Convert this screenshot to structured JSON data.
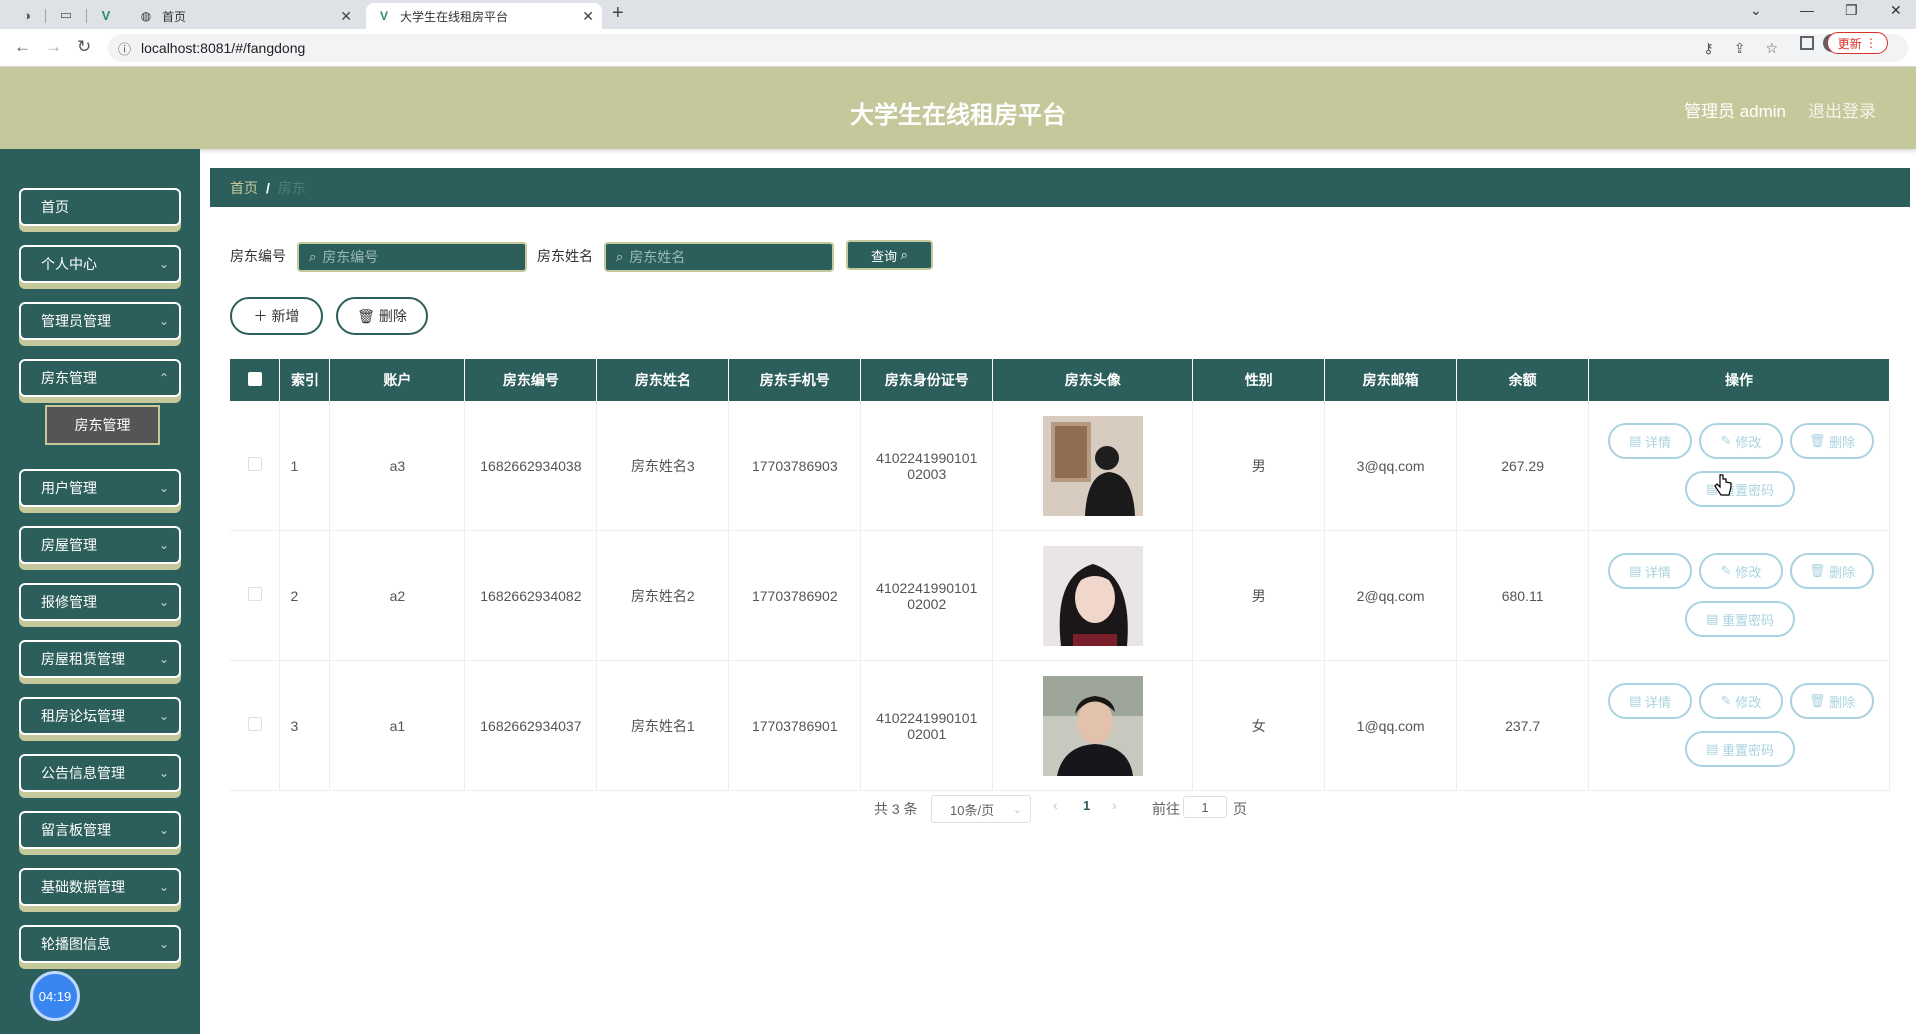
{
  "browser": {
    "tabs": [
      {
        "label": "首页",
        "favicon": "globe-icon"
      },
      {
        "label": "大学生在线租房平台",
        "favicon": "vue-icon"
      }
    ],
    "url": "localhost:8081/#/fangdong",
    "update_label": "更新"
  },
  "header": {
    "title": "大学生在线租房平台",
    "user": "管理员 admin",
    "logout": "退出登录"
  },
  "sidebar": {
    "items": [
      {
        "label": "首页"
      },
      {
        "label": "个人中心"
      },
      {
        "label": "管理员管理"
      },
      {
        "label": "房东管理"
      },
      {
        "label": "用户管理"
      },
      {
        "label": "房屋管理"
      },
      {
        "label": "报修管理"
      },
      {
        "label": "房屋租赁管理"
      },
      {
        "label": "租房论坛管理"
      },
      {
        "label": "公告信息管理"
      },
      {
        "label": "留言板管理"
      },
      {
        "label": "基础数据管理"
      },
      {
        "label": "轮播图信息"
      }
    ],
    "submenu_active": "房东管理",
    "clock": "04:19"
  },
  "breadcrumb": {
    "home": "首页",
    "sep": "/",
    "current": "房东"
  },
  "search": {
    "label_id": "房东编号",
    "placeholder_id": "房东编号",
    "label_name": "房东姓名",
    "placeholder_name": "房东姓名",
    "query": "查询"
  },
  "actions": {
    "add": "新增",
    "delete": "删除"
  },
  "table": {
    "headers": [
      "索引",
      "账户",
      "房东编号",
      "房东姓名",
      "房东手机号",
      "房东身份证号",
      "房东头像",
      "性别",
      "房东邮箱",
      "余额",
      "操作"
    ],
    "rows": [
      {
        "index": "1",
        "account": "a3",
        "uuid": "1682662934038",
        "name": "房东姓名3",
        "phone": "17703786903",
        "id_line1": "4102241990101",
        "id_line2": "02003",
        "gender": "男",
        "email": "3@qq.com",
        "balance": "267.29"
      },
      {
        "index": "2",
        "account": "a2",
        "uuid": "1682662934082",
        "name": "房东姓名2",
        "phone": "17703786902",
        "id_line1": "4102241990101",
        "id_line2": "02002",
        "gender": "男",
        "email": "2@qq.com",
        "balance": "680.11"
      },
      {
        "index": "3",
        "account": "a1",
        "uuid": "1682662934037",
        "name": "房东姓名1",
        "phone": "17703786901",
        "id_line1": "4102241990101",
        "id_line2": "02001",
        "gender": "女",
        "email": "1@qq.com",
        "balance": "237.7"
      }
    ],
    "ops": {
      "detail": "详情",
      "edit": "修改",
      "delete": "删除",
      "reset": "重置密码"
    }
  },
  "pagination": {
    "total": "共 3 条",
    "page_size": "10条/页",
    "current": "1",
    "goto_prefix": "前往",
    "goto_value": "1",
    "goto_suffix": "页"
  }
}
